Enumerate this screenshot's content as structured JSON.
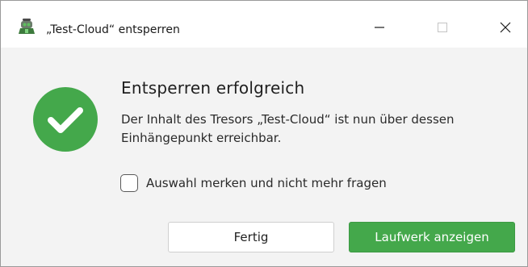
{
  "window": {
    "title": "„Test-Cloud“ entsperren",
    "app_icon": "cryptomator-robot-icon",
    "controls": {
      "minimize_icon": "minimize-icon",
      "maximize_icon": "maximize-icon",
      "close_icon": "close-icon"
    }
  },
  "content": {
    "status_icon": "success-check-icon",
    "status_color": "#44a84b",
    "heading": "Entsperren erfolgreich",
    "message": "Der Inhalt des Tresors „Test-Cloud“ ist nun über dessen Einhängepunkt erreichbar.",
    "remember_choice": {
      "label": "Auswahl merken und nicht mehr fragen",
      "checked": false
    }
  },
  "buttons": {
    "done_label": "Fertig",
    "reveal_label": "Laufwerk anzeigen",
    "accent_color": "#44a84b"
  }
}
